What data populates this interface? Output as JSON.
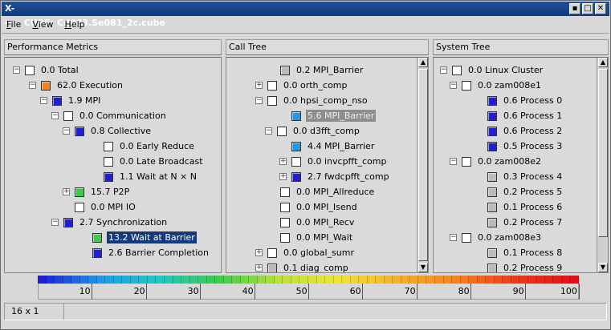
{
  "window": {
    "title": "CUBE:  Cd083.Se081_2c.cube",
    "app_icon": "X-→",
    "controls": [
      "▪",
      "□",
      "✕"
    ]
  },
  "menu": [
    "File",
    "View",
    "Help"
  ],
  "panes": {
    "metrics": {
      "header": "Performance Metrics",
      "rows": [
        {
          "label": "0.0 Total",
          "color": "#ffffff",
          "expander": "-"
        },
        {
          "label": "62.0 Execution",
          "color": "#f5821e",
          "expander": "-"
        },
        {
          "label": "1.9 MPI",
          "color": "#1f1fd6",
          "expander": "-"
        },
        {
          "label": "0.0 Communication",
          "color": "#ffffff",
          "expander": "-"
        },
        {
          "label": "0.8 Collective",
          "color": "#1f1fd6",
          "expander": "-"
        },
        {
          "label": "0.0 Early Reduce",
          "color": "#ffffff",
          "expander": ""
        },
        {
          "label": "0.0 Late Broadcast",
          "color": "#ffffff",
          "expander": ""
        },
        {
          "label": "1.1 Wait at N × N",
          "color": "#1f1fd6",
          "expander": ""
        },
        {
          "label": "15.7 P2P",
          "color": "#3ecb4a",
          "expander": "+"
        },
        {
          "label": "0.0 MPI IO",
          "color": "#ffffff",
          "expander": ""
        },
        {
          "label": "2.7 Synchronization",
          "color": "#1f1fd6",
          "expander": "-"
        },
        {
          "label": "13.2 Wait at Barrier",
          "color": "#3ecb4a",
          "expander": "",
          "selected": true
        },
        {
          "label": "2.6 Barrier Completion",
          "color": "#1f1fd6",
          "expander": ""
        }
      ]
    },
    "calltree": {
      "header": "Call Tree",
      "rows": [
        {
          "label": "0.2 MPI_Barrier",
          "color": "#bbbbbb",
          "expander": ""
        },
        {
          "label": "0.0 orth_comp",
          "color": "#ffffff",
          "expander": "+"
        },
        {
          "label": "0.0 hpsi_comp_nso",
          "color": "#ffffff",
          "expander": "-"
        },
        {
          "label": "5.6 MPI_Barrier",
          "color": "#1e9ae8",
          "expander": "",
          "selected": true
        },
        {
          "label": "0.0 d3fft_comp",
          "color": "#ffffff",
          "expander": "-"
        },
        {
          "label": "4.4 MPI_Barrier",
          "color": "#1e9ae8",
          "expander": ""
        },
        {
          "label": "0.0 invcpfft_comp",
          "color": "#ffffff",
          "expander": "+"
        },
        {
          "label": "2.7 fwdcpfft_comp",
          "color": "#1f1fd6",
          "expander": "+"
        },
        {
          "label": "0.0 MPI_Allreduce",
          "color": "#ffffff",
          "expander": ""
        },
        {
          "label": "0.0 MPI_Isend",
          "color": "#ffffff",
          "expander": ""
        },
        {
          "label": "0.0 MPI_Recv",
          "color": "#ffffff",
          "expander": ""
        },
        {
          "label": "0.0 MPI_Wait",
          "color": "#ffffff",
          "expander": ""
        },
        {
          "label": "0.0 global_sumr",
          "color": "#ffffff",
          "expander": "+"
        },
        {
          "label": "0.1 diag_comp",
          "color": "#bbbbbb",
          "expander": "+"
        }
      ]
    },
    "systemtree": {
      "header": "System Tree",
      "rows": [
        {
          "label": "0.0 Linux Cluster",
          "color": "#ffffff",
          "expander": "-"
        },
        {
          "label": "0.0 zam008e1",
          "color": "#ffffff",
          "expander": "-"
        },
        {
          "label": "0.6 Process 0",
          "color": "#1f1fd6",
          "expander": ""
        },
        {
          "label": "0.6 Process 1",
          "color": "#1f1fd6",
          "expander": ""
        },
        {
          "label": "0.6 Process 2",
          "color": "#1f1fd6",
          "expander": ""
        },
        {
          "label": "0.5 Process 3",
          "color": "#1f1fd6",
          "expander": ""
        },
        {
          "label": "0.0 zam008e2",
          "color": "#ffffff",
          "expander": "-"
        },
        {
          "label": "0.3 Process 4",
          "color": "#bbbbbb",
          "expander": ""
        },
        {
          "label": "0.2 Process 5",
          "color": "#bbbbbb",
          "expander": ""
        },
        {
          "label": "0.1 Process 6",
          "color": "#bbbbbb",
          "expander": ""
        },
        {
          "label": "0.2 Process 7",
          "color": "#bbbbbb",
          "expander": ""
        },
        {
          "label": "0.0 zam008e3",
          "color": "#ffffff",
          "expander": "-"
        },
        {
          "label": "0.1 Process 8",
          "color": "#bbbbbb",
          "expander": ""
        },
        {
          "label": "0.2 Process 9",
          "color": "#bbbbbb",
          "expander": ""
        }
      ]
    }
  },
  "colorscale": {
    "ticks": [
      "10",
      "20",
      "30",
      "40",
      "50",
      "60",
      "70",
      "80",
      "90",
      "100"
    ],
    "gradient": [
      "#1f1fd6",
      "#1e9ae8",
      "#24c6c0",
      "#3ecb4a",
      "#b8e23a",
      "#f0e437",
      "#f5b12b",
      "#f5821e",
      "#ef3a1a",
      "#e0101a"
    ]
  },
  "status": {
    "cell": "16 x 1"
  }
}
